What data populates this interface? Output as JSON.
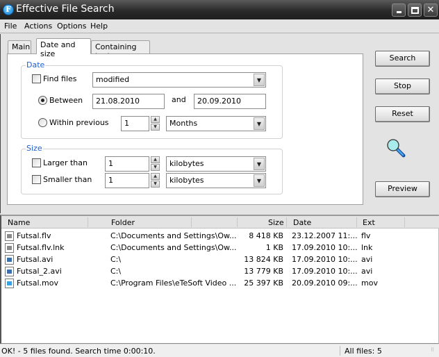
{
  "window": {
    "title": "Effective File Search",
    "app_icon_letter": "F",
    "controls": {
      "minimize": "minimize",
      "maximize": "maximize",
      "close": "✕"
    }
  },
  "menu": [
    "File",
    "Actions",
    "Options",
    "Help"
  ],
  "tabs": [
    {
      "label": "Main",
      "active": false
    },
    {
      "label": "Date and size",
      "active": true
    },
    {
      "label": "Containing text",
      "active": false
    }
  ],
  "date_group": {
    "label": "Date",
    "find_files": {
      "label": "Find files",
      "checked": false,
      "mode": "modified"
    },
    "between": {
      "label": "Between",
      "selected": true,
      "from": "21.08.2010",
      "and_label": "and",
      "to": "20.09.2010"
    },
    "within": {
      "label": "Within previous",
      "selected": false,
      "value": "1",
      "unit": "Months"
    }
  },
  "size_group": {
    "label": "Size",
    "larger": {
      "label": "Larger than",
      "checked": false,
      "value": "1",
      "unit": "kilobytes"
    },
    "smaller": {
      "label": "Smaller than",
      "checked": false,
      "value": "1",
      "unit": "kilobytes"
    }
  },
  "buttons": {
    "search": "Search",
    "stop": "Stop",
    "reset": "Reset",
    "preview": "Preview"
  },
  "results": {
    "columns": [
      "Name",
      "Folder",
      "Size",
      "Date",
      "Ext"
    ],
    "rows": [
      {
        "name": "Futsal.flv",
        "folder": "C:\\Documents and Settings\\Ow...",
        "size": "8 418 KB",
        "date": "23.12.2007 11:...",
        "ext": "flv",
        "icon": "flash-video-file-icon"
      },
      {
        "name": "Futsal.flv.lnk",
        "folder": "C:\\Documents and Settings\\Ow...",
        "size": "1 KB",
        "date": "17.09.2010 10:...",
        "ext": "lnk",
        "icon": "shortcut-file-icon"
      },
      {
        "name": "Futsal.avi",
        "folder": "C:\\",
        "size": "13 824 KB",
        "date": "17.09.2010 10:...",
        "ext": "avi",
        "icon": "video-file-icon"
      },
      {
        "name": "Futsal_2.avi",
        "folder": "C:\\",
        "size": "13 779 KB",
        "date": "17.09.2010 10:...",
        "ext": "avi",
        "icon": "video-file-icon"
      },
      {
        "name": "Futsal.mov",
        "folder": "C:\\Program Files\\eTeSoft Video ...",
        "size": "25 397 KB",
        "date": "20.09.2010 09:...",
        "ext": "mov",
        "icon": "quicktime-file-icon"
      }
    ]
  },
  "status": {
    "message": "OK! - 5 files found. Search time 0:00:10.",
    "count": "All files: 5"
  }
}
